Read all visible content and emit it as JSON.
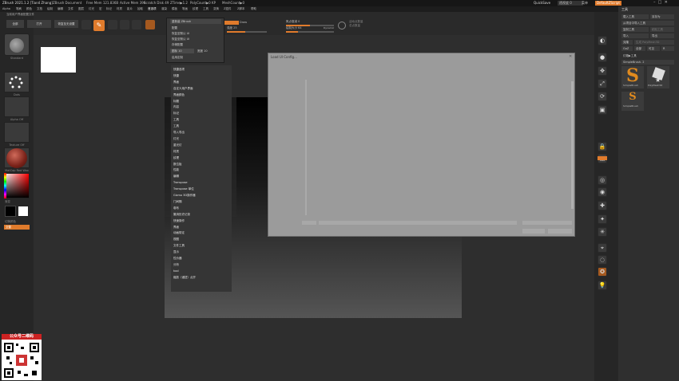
{
  "titlebar": {
    "app": "ZBrush 2021.1.2 [Tian4 Zhang]",
    "document": "ZBrush Document",
    "free_mem": "Free Mem 121.836B",
    "active_mem": "Active Mem 396",
    "scratch_disk": "Scratch Disk 49",
    "ztime": "ZTime▶1.2",
    "polycount": "PolyCount▶0 KP",
    "meshcount": "MeshCount▶0",
    "quicksave": "QuickSave",
    "see_through": "透视度 0",
    "menus": "菜单",
    "default_script": "DefaultZScript"
  },
  "menubar": {
    "items": [
      "Alpha",
      "笔刷",
      "颜色",
      "文档",
      "绘制",
      "编辑",
      "文件",
      "图层",
      "灯光",
      "宏",
      "标记",
      "材质",
      "影片",
      "拾取",
      "首选项",
      "渲染",
      "模板",
      "笔画",
      "纹理",
      "工具",
      "变换",
      "Z插件",
      "Z脚本",
      "帮助"
    ]
  },
  "left_toolbar": {
    "title": "当前用户界面配置文件",
    "btn_all": "全部",
    "btn_open": "打开",
    "btn_recent": "恢复至无设置",
    "brush_label": "Standard",
    "stroke_label": "Dots",
    "alpha_label": "Alpha Off",
    "texture_label": "Texture Off",
    "material_label": "MatCap Red Wax",
    "gradient_label": "渐变",
    "switch_color_label": "切换颜色",
    "alternate_label": "交替"
  },
  "dropdown": {
    "header": "重新装 ZBrush",
    "items": [
      "配置",
      "恢复至默认 UI",
      "恢复至默认 UI",
      "存储配置",
      "加载 UI",
      "启用定制"
    ],
    "slider_label": "图标 10",
    "slider_value": "宽度 10"
  },
  "top_controls": {
    "draw_label": "Draw",
    "intensity_label": "强度 25",
    "focal_label": "焦点衰减 0",
    "size_label": "绘制大小 64",
    "dynamic_label": "Dynamic",
    "active_points": "活动点数量",
    "total_points": "总点数量"
  },
  "menu_list": {
    "items": [
      "快捷选项",
      "快捷",
      "界面",
      "自定义用户界面",
      "界面颜色",
      "标题",
      "内容",
      "标记",
      "工具",
      "工具",
      "导入导出",
      "灯光",
      "重光灯",
      "材质",
      "纹理",
      "数位板",
      "性能",
      "编辑",
      "Transpose",
      "Transpose 单位",
      "Gizmo 3D操作器",
      "门间隔",
      "卷布",
      "撤消历史记录",
      "快速操作",
      "界面",
      "动画带定",
      "视图",
      "文件工具",
      "显示",
      "性价器",
      "分析",
      "tool",
      "缩放（诸扭）点开"
    ]
  },
  "dialog": {
    "title": "Load UI Config..."
  },
  "right_shelf": {
    "icons": [
      "bpr-icon",
      "sphere-icon",
      "move-icon",
      "scale-icon",
      "rotate-icon",
      "frame-icon",
      "lock-icon",
      "transparency-icon",
      "ghost-icon",
      "solo-icon",
      "xpose-icon",
      "lightbulb-icon"
    ]
  },
  "tool_panel": {
    "title": "工具",
    "load_tool": "载入工具",
    "save_as": "另存为",
    "import": "从项目中导入工具",
    "copy_tool": "复制工具",
    "paste_tool": "粘贴工具",
    "import2": "导入",
    "export": "导出",
    "clone": "克隆",
    "make_polymesh": "生成 PolyMesh3D",
    "goz": "GoZ",
    "all": "全部",
    "visible": "可见",
    "r": "R",
    "lightbox": "灯箱▶工具",
    "current_tool": "SimpleBrush. 2",
    "tool1": "SimpleBrush",
    "tool2": "PolyMesh3D",
    "tool3": "SimpleBrush"
  },
  "watermark": {
    "title": "公众号二维码"
  }
}
